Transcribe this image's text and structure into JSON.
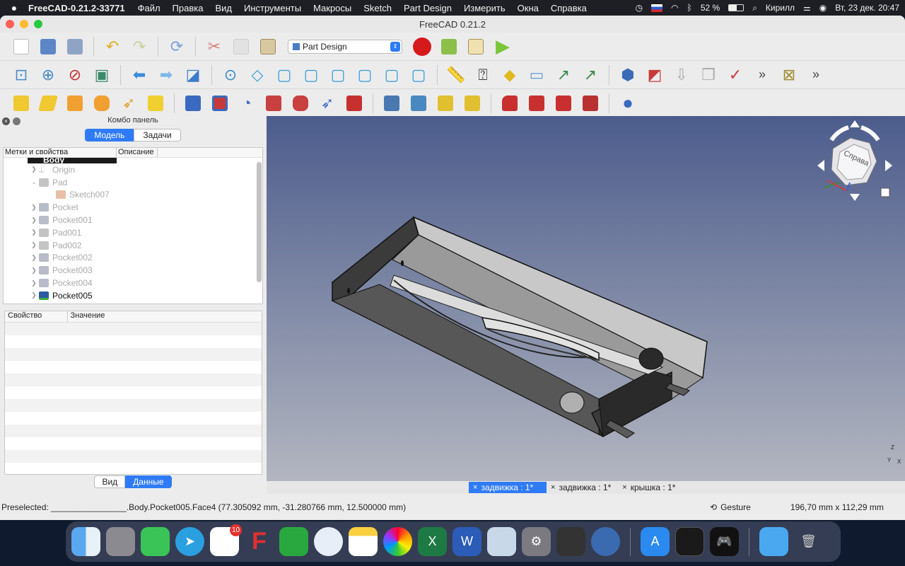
{
  "menubar": {
    "app_name": "FreeCAD-0.21.2-33771",
    "items": [
      "Файл",
      "Правка",
      "Вид",
      "Инструменты",
      "Макросы",
      "Sketch",
      "Part Design",
      "Измерить",
      "Окна",
      "Справка"
    ],
    "battery": "52 %",
    "user": "Кирилл",
    "datetime": "Вт, 23 дек.  20:47"
  },
  "window": {
    "title": "FreeCAD 0.21.2"
  },
  "toolbar": {
    "workbench": "Part Design"
  },
  "combo_panel": {
    "title": "Комбо панель",
    "tabs": {
      "model": "Модель",
      "tasks": "Задачи"
    },
    "tree_headers": {
      "labels": "Метки и свойства",
      "description": "Описание"
    },
    "tree_items": [
      {
        "label": "Body",
        "level": 0
      },
      {
        "label": "Origin",
        "level": 1
      },
      {
        "label": "Pad",
        "level": 1
      },
      {
        "label": "Sketch007",
        "level": 2
      },
      {
        "label": "Pocket",
        "level": 1
      },
      {
        "label": "Pocket001",
        "level": 1
      },
      {
        "label": "Pad001",
        "level": 1
      },
      {
        "label": "Pad002",
        "level": 1
      },
      {
        "label": "Pocket002",
        "level": 1
      },
      {
        "label": "Pocket003",
        "level": 1
      },
      {
        "label": "Pocket004",
        "level": 1
      },
      {
        "label": "Pocket005",
        "level": 1
      }
    ],
    "prop_headers": {
      "property": "Свойство",
      "value": "Значение"
    },
    "bottom_tabs": {
      "view": "Вид",
      "data": "Данные"
    }
  },
  "viewcube": {
    "face_label": "Справа"
  },
  "axes": {
    "z": "Z",
    "y": "Y",
    "x": "X"
  },
  "doc_tabs": [
    "задвижка : 1*",
    "задвижка : 1*",
    "крышка : 1*"
  ],
  "status": {
    "preselected": "Preselected: ________________.Body.Pocket005.Face4 (77.305092 mm, -31.280766 mm, 12.500000 mm)",
    "nav_style": "Gesture",
    "dimensions": "196,70 mm x 112,29 mm"
  },
  "dock": {
    "reminders_badge": "10"
  }
}
